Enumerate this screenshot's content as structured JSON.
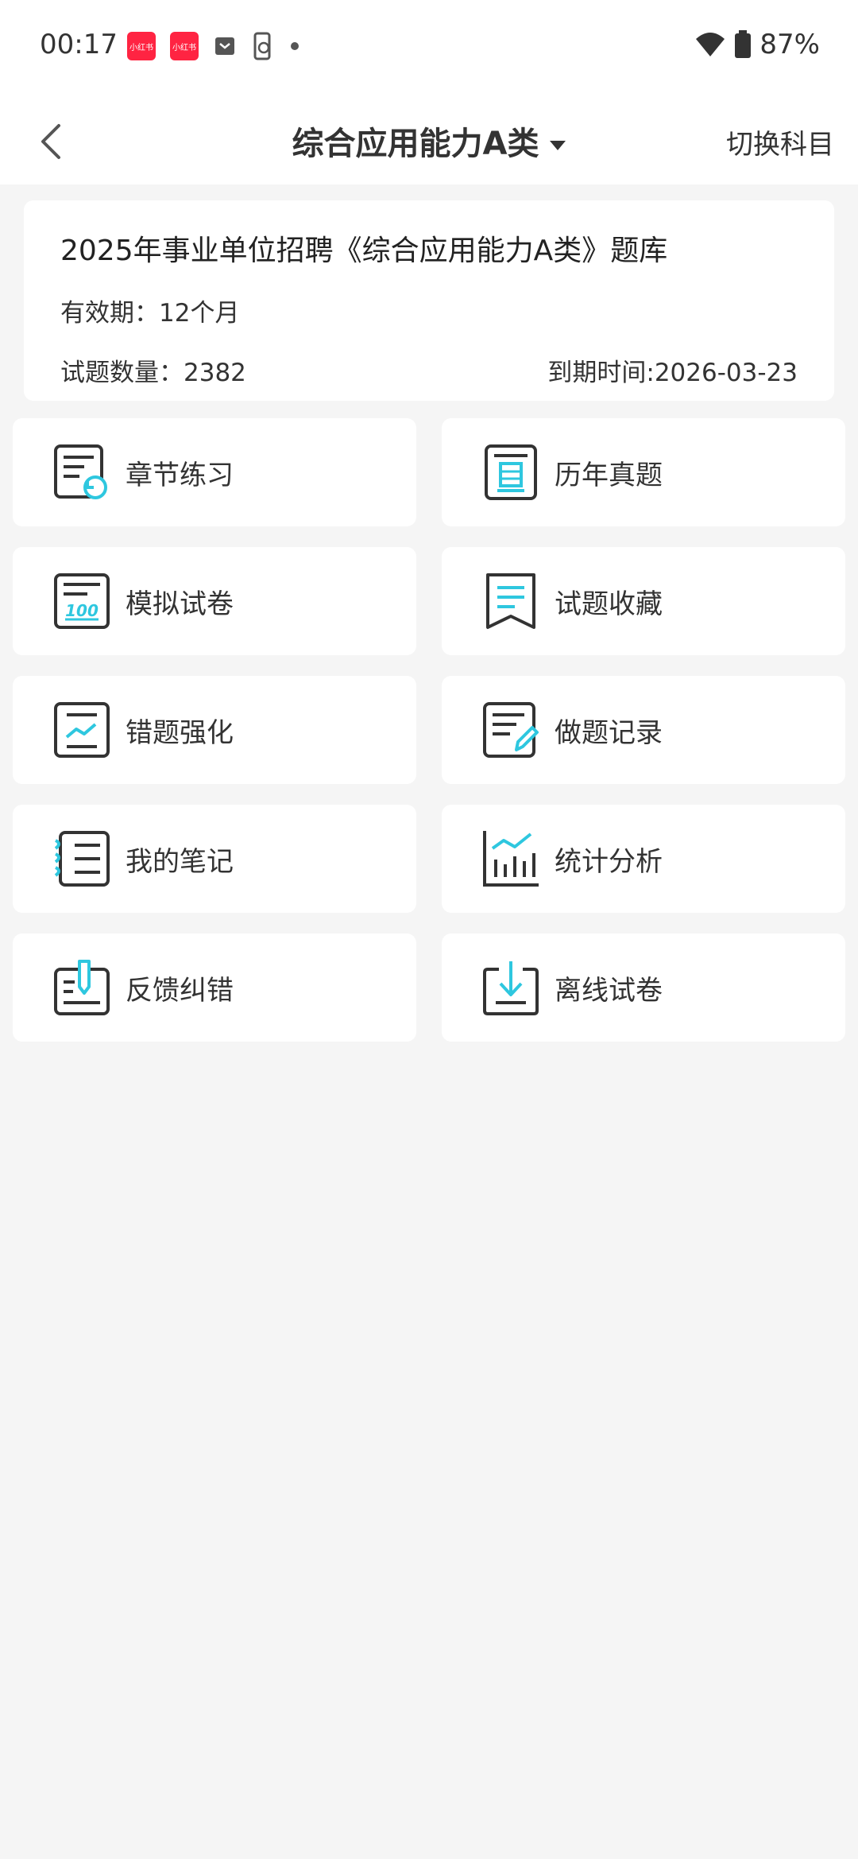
{
  "status_bar": {
    "time": "00:17",
    "battery": "87%",
    "app_badge_1": "小红书",
    "app_badge_2": "小红书"
  },
  "nav": {
    "title": "综合应用能力A类",
    "switch_label": "切换科目"
  },
  "info": {
    "title": "2025年事业单位招聘《综合应用能力A类》题库",
    "validity": "有效期：12个月",
    "count": "试题数量：2382",
    "expire": "到期时间:2026-03-23"
  },
  "tiles": [
    {
      "label": "章节练习",
      "icon": "chapter-practice-icon"
    },
    {
      "label": "历年真题",
      "icon": "past-exam-icon"
    },
    {
      "label": "模拟试卷",
      "icon": "mock-paper-icon"
    },
    {
      "label": "试题收藏",
      "icon": "favorites-icon"
    },
    {
      "label": "错题强化",
      "icon": "wrong-question-icon"
    },
    {
      "label": "做题记录",
      "icon": "record-icon"
    },
    {
      "label": "我的笔记",
      "icon": "notes-icon"
    },
    {
      "label": "统计分析",
      "icon": "statistics-icon"
    },
    {
      "label": "反馈纠错",
      "icon": "feedback-icon"
    },
    {
      "label": "离线试卷",
      "icon": "offline-download-icon"
    }
  ],
  "colors": {
    "accent": "#2ec7df",
    "icon_stroke": "#333333",
    "background": "#f5f5f5"
  }
}
